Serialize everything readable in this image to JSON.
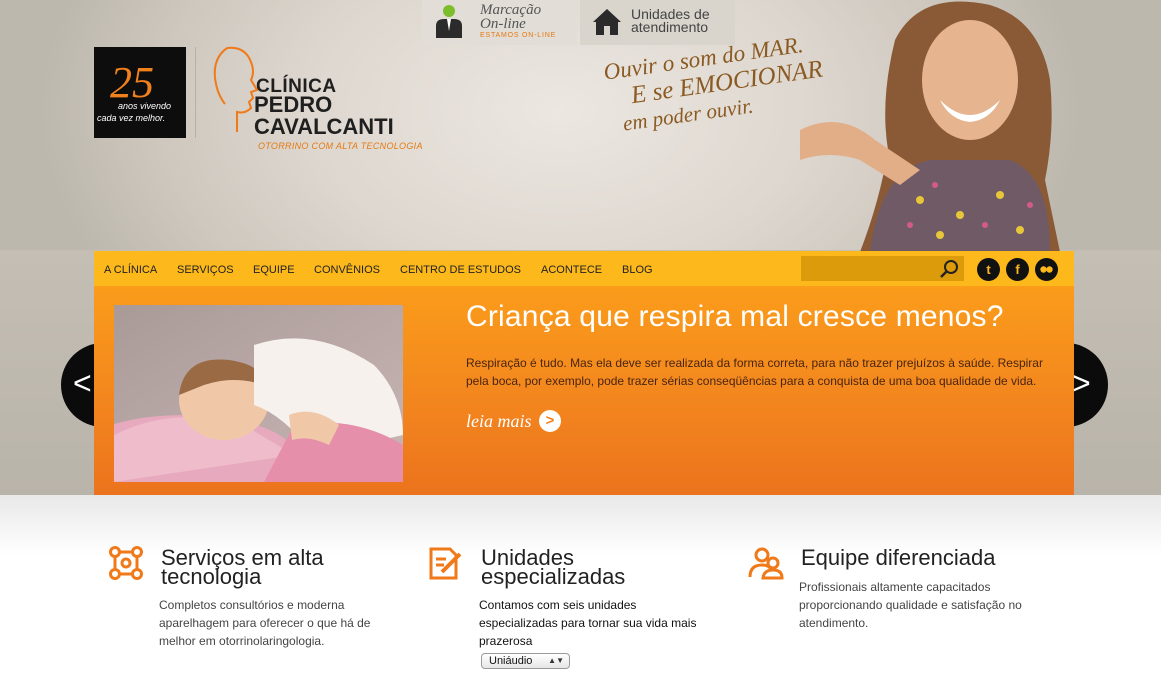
{
  "top_tabs": {
    "marcacao": {
      "line1": "Marcação",
      "line2": "On-line",
      "status": "ESTAMOS ON-LINE"
    },
    "unidades": {
      "line1": "Unidades de",
      "line2": "atendimento"
    }
  },
  "logo": {
    "years": "25",
    "years_caption_1": "anos vivendo",
    "years_caption_2": "cada vez melhor.",
    "name_1": "CLÍNICA",
    "name_2": "PEDRO",
    "name_3": "CAVALCANTI",
    "tagline": "OTORRINO COM ALTA TECNOLOGIA"
  },
  "slogan": {
    "line1": "Ouvir o som do MAR.",
    "line2": "E se EMOCIONAR",
    "line3": "em poder ouvir."
  },
  "nav": {
    "items": [
      "A CLÍNICA",
      "SERVIÇOS",
      "EQUIPE",
      "CONVÊNIOS",
      "CENTRO DE ESTUDOS",
      "ACONTECE",
      "BLOG"
    ],
    "search_value": "",
    "social": [
      "twitter-icon",
      "facebook-icon",
      "flickr-icon"
    ]
  },
  "slide": {
    "title": "Criança que respira mal cresce menos?",
    "text": "Respiração é tudo. Mas ela deve ser realizada da forma correta, para não trazer prejuízos à saúde. Respirar pela boca, por exemplo, pode trazer sérias conseqüências para a conquista de uma boa qualidade de vida.",
    "read_more": "leia mais",
    "prev": "<",
    "next": ">"
  },
  "features": [
    {
      "icon": "molecule-icon",
      "title_1": "Serviços em alta",
      "title_2": "tecnologia",
      "text": "Completos consultórios e moderna aparelhagem para oferecer o que há de melhor em otorrinolaringologia."
    },
    {
      "icon": "document-edit-icon",
      "title_1": "Unidades",
      "title_2": "especializadas",
      "text": "Contamos com seis unidades especializadas para tornar sua vida mais prazerosa",
      "select_value": "Uniáudio"
    },
    {
      "icon": "people-icon",
      "title_1": "Equipe diferenciada",
      "title_2": "",
      "text": "Profissionais altamente capacitados proporcionando qualidade e satisfação no atendimento."
    }
  ],
  "colors": {
    "accent": "#fdb81c",
    "slide_orange": "#f48a1e",
    "icon_orange": "#f07a1a"
  }
}
